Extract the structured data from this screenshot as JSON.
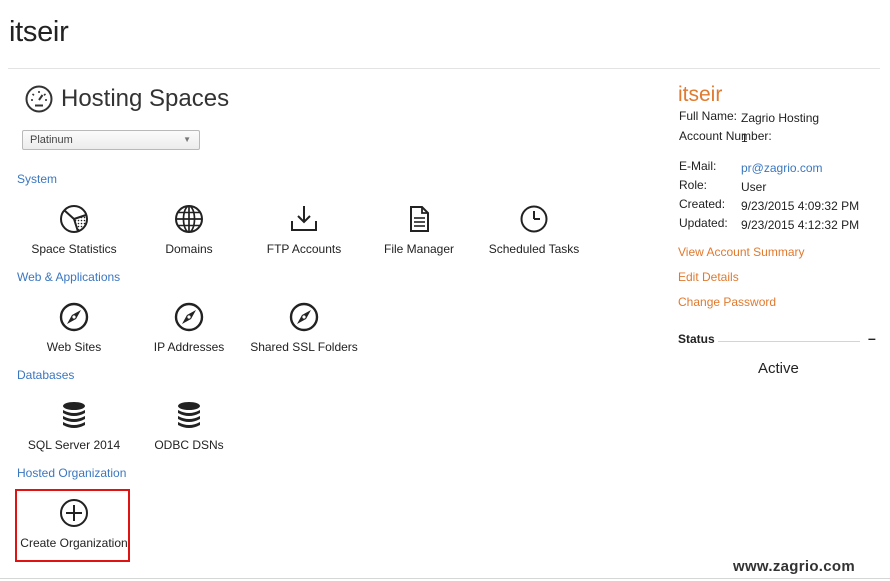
{
  "page": {
    "title": "itseir"
  },
  "hosting_spaces": {
    "title": "Hosting Spaces",
    "icon": "gauge-icon",
    "plan_select": {
      "value": "Platinum"
    }
  },
  "sections": {
    "system": {
      "label": "System",
      "items": [
        {
          "label": "Space Statistics",
          "icon": "pie-chart-icon"
        },
        {
          "label": "Domains",
          "icon": "globe-icon"
        },
        {
          "label": "FTP Accounts",
          "icon": "download-icon"
        },
        {
          "label": "File Manager",
          "icon": "document-icon"
        },
        {
          "label": "Scheduled Tasks",
          "icon": "clock-icon"
        }
      ]
    },
    "web": {
      "label": "Web & Applications",
      "items": [
        {
          "label": "Web Sites",
          "icon": "compass-icon"
        },
        {
          "label": "IP Addresses",
          "icon": "compass-icon"
        },
        {
          "label": "Shared SSL Folders",
          "icon": "compass-icon"
        }
      ]
    },
    "databases": {
      "label": "Databases",
      "items": [
        {
          "label": "SQL Server 2014",
          "icon": "database-icon"
        },
        {
          "label": "ODBC DSNs",
          "icon": "database-icon"
        }
      ]
    },
    "hosted_org": {
      "label": "Hosted Organization",
      "items": [
        {
          "label": "Create Organization",
          "icon": "plus-circle-icon"
        }
      ]
    }
  },
  "account": {
    "name": "itseir",
    "fields": {
      "full_name_key": "Full Name:",
      "full_name": "Zagrio Hosting",
      "account_number_key": "Account Number:",
      "account_number": "1",
      "email_key": "E-Mail:",
      "email": "pr@zagrio.com",
      "role_key": "Role:",
      "role": "User",
      "created_key": "Created:",
      "created": "9/23/2015 4:09:32 PM",
      "updated_key": "Updated:",
      "updated": "9/23/2015 4:12:32 PM"
    },
    "links": {
      "view_summary": "View Account Summary",
      "edit_details": "Edit Details",
      "change_password": "Change Password"
    }
  },
  "status": {
    "label": "Status",
    "collapse": "–",
    "value": "Active"
  },
  "watermark": "www.zagrio.com",
  "colors": {
    "link_blue": "#3a77c0",
    "accent_orange": "#e07a2f",
    "highlight_red": "#e01212"
  }
}
